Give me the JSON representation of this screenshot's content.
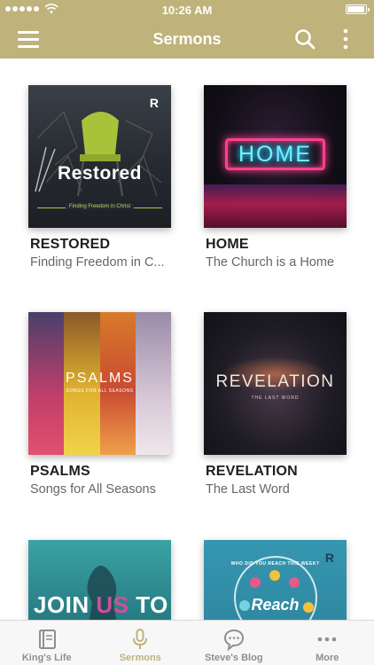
{
  "status_bar": {
    "time": "10:26 AM"
  },
  "nav": {
    "title": "Sermons"
  },
  "sermons": [
    {
      "title": "RESTORED",
      "subtitle": "Finding Freedom in C...",
      "art_text": "Restored",
      "art_tag": "Finding Freedom in Christ"
    },
    {
      "title": "HOME",
      "subtitle": "The Church is a Home",
      "art_text": "HOME"
    },
    {
      "title": "PSALMS",
      "subtitle": "Songs for All Seasons",
      "art_text": "PSALMS",
      "art_tag": "SONGS FOR ALL SEASONS"
    },
    {
      "title": "REVELATION",
      "subtitle": "The Last Word",
      "art_text": "REVELATION",
      "art_tag": "THE LAST WORD"
    },
    {
      "art_text_a": "JOIN ",
      "art_text_b": "US",
      "art_text_c": " TO"
    },
    {
      "art_text": "Reach",
      "art_tag": "WHO DID YOU REACH THIS WEEK?"
    }
  ],
  "tabs": [
    {
      "label": "King's Life",
      "icon": "book-icon"
    },
    {
      "label": "Sermons",
      "icon": "microphone-icon"
    },
    {
      "label": "Steve's Blog",
      "icon": "chat-bubble-icon"
    },
    {
      "label": "More",
      "icon": "more-horizontal-icon"
    }
  ],
  "colors": {
    "brand": "#bfb27a",
    "tab_inactive": "#8e8e93",
    "title_text": "#1e1e1e",
    "subtitle_text": "#666666"
  },
  "active_tab": "Sermons"
}
